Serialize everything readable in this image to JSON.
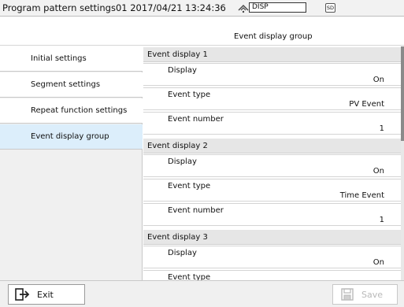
{
  "titlebar": {
    "title": "Program pattern settings01 2017/04/21 13:24:36",
    "disp_label": "DISP",
    "sd_label": "SD"
  },
  "page": {
    "header": "Event display group"
  },
  "sidebar": {
    "items": [
      {
        "label": "Initial settings"
      },
      {
        "label": "Segment settings"
      },
      {
        "label": "Repeat function settings"
      },
      {
        "label": "Event display group"
      }
    ]
  },
  "content": {
    "groups": [
      {
        "title": "Event display 1",
        "rows": [
          {
            "label": "Display",
            "value": "On"
          },
          {
            "label": "Event type",
            "value": "PV Event"
          },
          {
            "label": "Event number",
            "value": "1"
          }
        ]
      },
      {
        "title": "Event display 2",
        "rows": [
          {
            "label": "Display",
            "value": "On"
          },
          {
            "label": "Event type",
            "value": "Time Event"
          },
          {
            "label": "Event number",
            "value": "1"
          }
        ]
      },
      {
        "title": "Event display 3",
        "rows": [
          {
            "label": "Display",
            "value": "On"
          },
          {
            "label": "Event type",
            "value": ""
          }
        ]
      }
    ]
  },
  "footer": {
    "exit_label": "Exit",
    "save_label": "Save"
  }
}
